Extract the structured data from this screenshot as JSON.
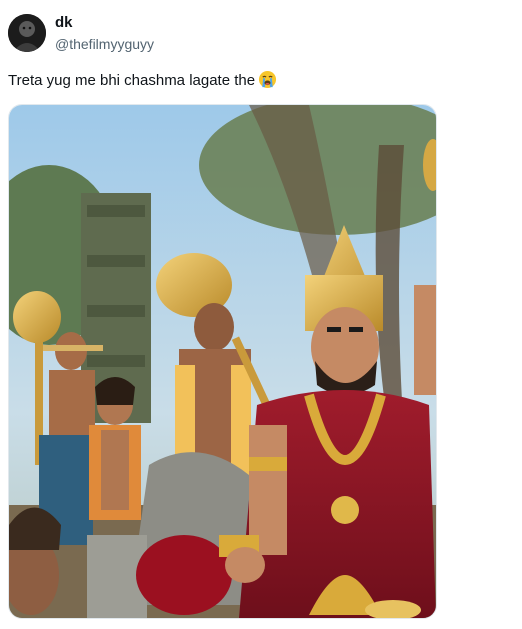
{
  "tweet": {
    "author": {
      "display_name": "dk",
      "handle": "@thefilmyyguyy",
      "avatar_icon": "profile-avatar"
    },
    "text": "Treta yug me bhi chashma lagate the",
    "emoji": "loudly-crying-face-icon",
    "media": {
      "type": "photo",
      "description_icon": "mythological-scene-photo"
    }
  },
  "colors": {
    "text_primary": "#0f1419",
    "text_secondary": "#536471",
    "background": "#ffffff"
  }
}
